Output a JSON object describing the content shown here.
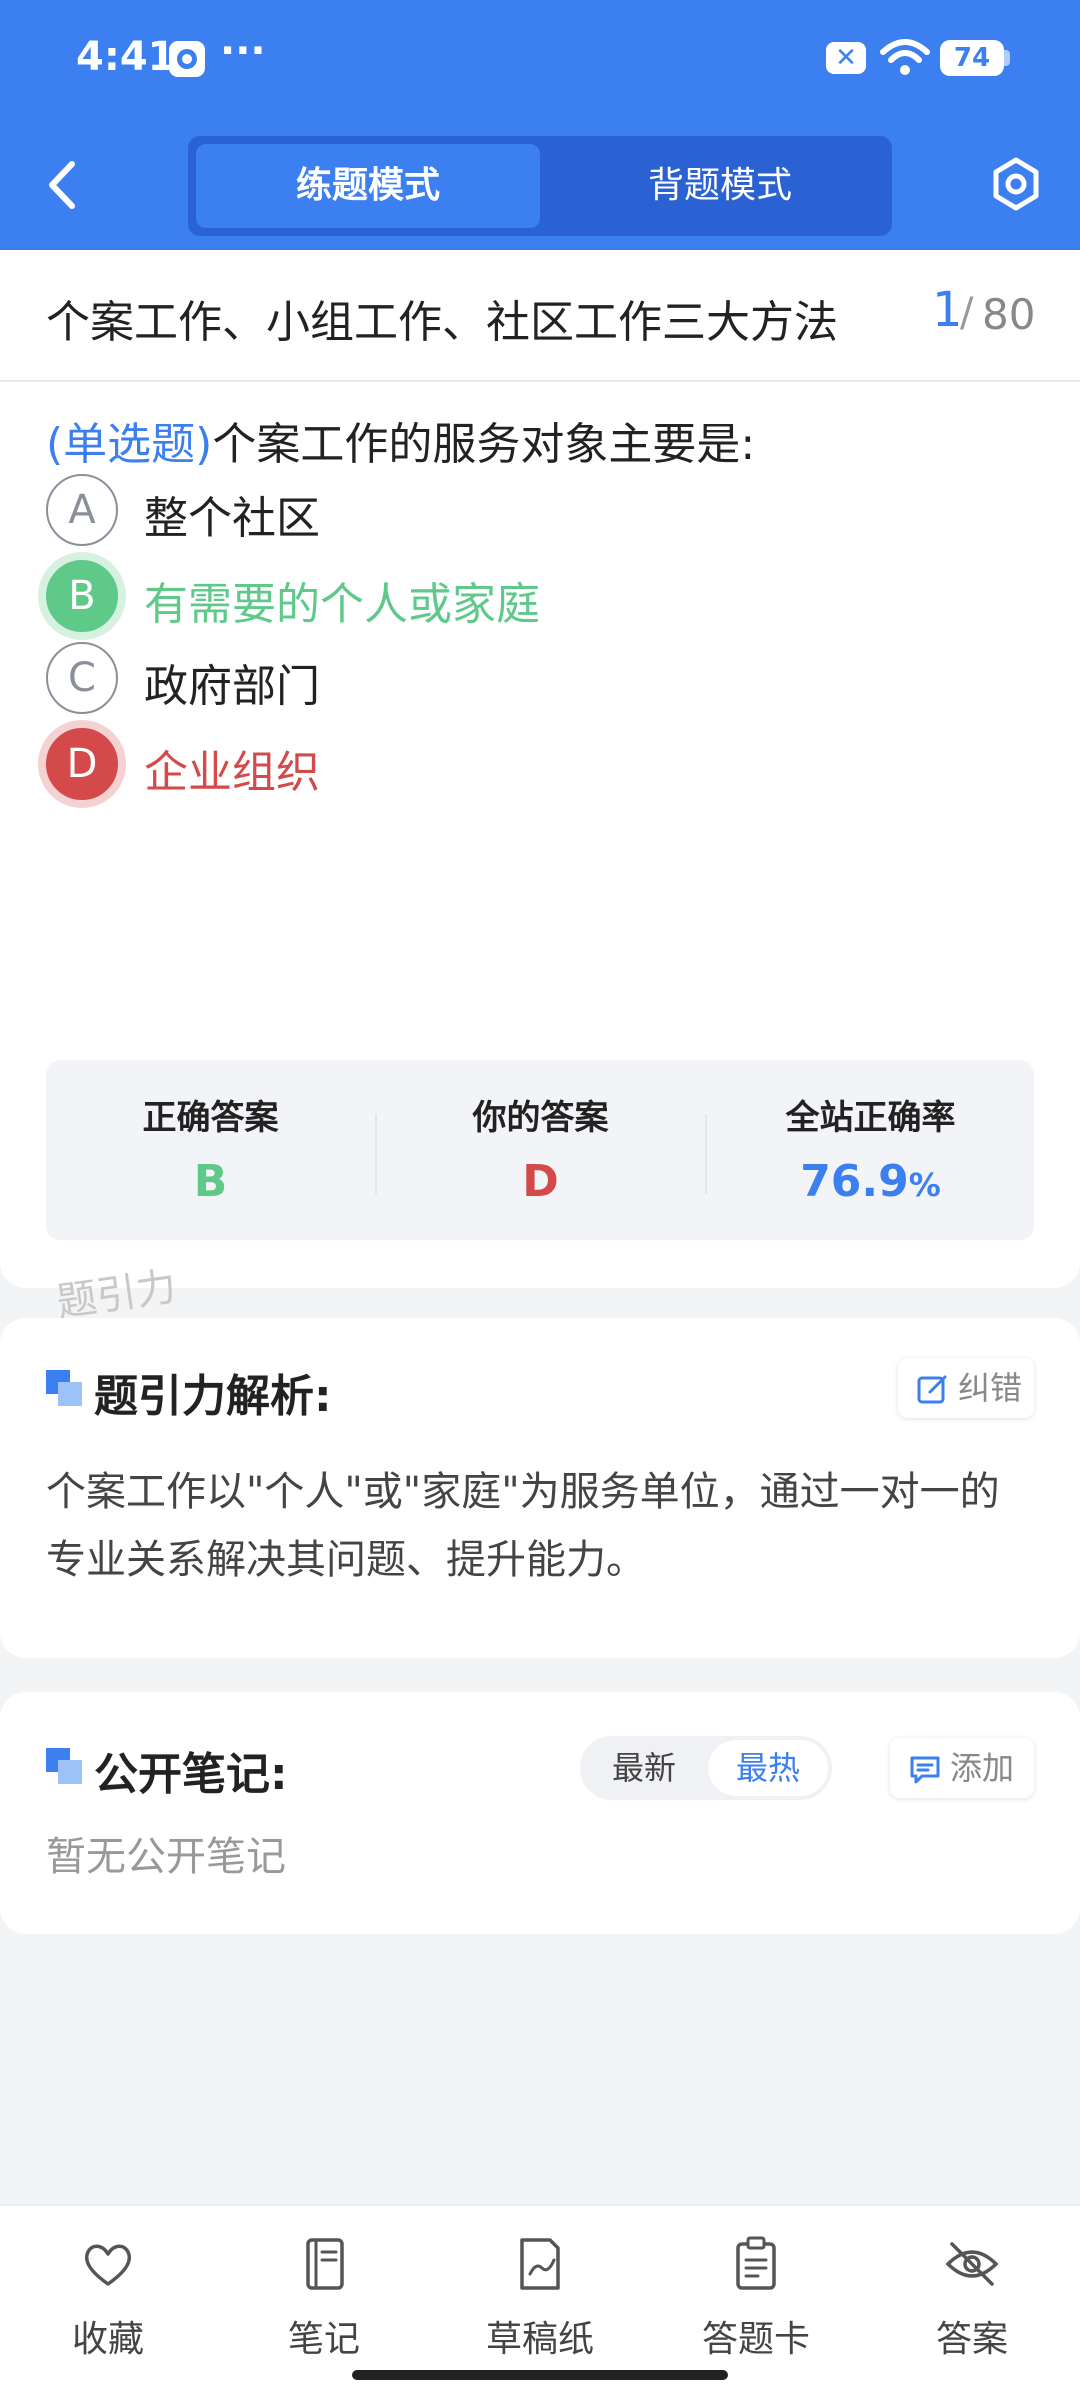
{
  "status_bar": {
    "time": "4:41",
    "battery": "74",
    "more": "···"
  },
  "header": {
    "mode_tabs": [
      {
        "label": "练题模式",
        "active": true
      },
      {
        "label": "背题模式",
        "active": false
      }
    ]
  },
  "title_bar": {
    "chapter_title": "个案工作、小组工作、社区工作三大方法",
    "current": "1",
    "separator": "/",
    "total": "80"
  },
  "question": {
    "type": "(单选题)",
    "text": "个案工作的服务对象主要是:",
    "options": [
      {
        "letter": "A",
        "text": "整个社区",
        "state": "normal"
      },
      {
        "letter": "B",
        "text": "有需要的个人或家庭",
        "state": "correct"
      },
      {
        "letter": "C",
        "text": "政府部门",
        "state": "normal"
      },
      {
        "letter": "D",
        "text": "企业组织",
        "state": "wrong"
      }
    ]
  },
  "answer_panel": {
    "correct_label": "正确答案",
    "correct_value": "B",
    "yours_label": "你的答案",
    "yours_value": "D",
    "rate_label": "全站正确率",
    "rate_value": "76.9",
    "rate_unit": "%"
  },
  "watermark": "题引力",
  "analysis": {
    "title": "题引力解析:",
    "report_button": "纠错",
    "body": "个案工作以\"个人\"或\"家庭\"为服务单位，通过一对一的专业关系解决其问题、提升能力。"
  },
  "notes": {
    "title": "公开笔记:",
    "sort_newest": "最新",
    "sort_hottest": "最热",
    "add_button": "添加",
    "empty_text": "暂无公开笔记"
  },
  "bottom_nav": [
    {
      "label": "收藏",
      "icon": "heart-icon"
    },
    {
      "label": "笔记",
      "icon": "notebook-icon"
    },
    {
      "label": "草稿纸",
      "icon": "scratch-paper-icon"
    },
    {
      "label": "答题卡",
      "icon": "answer-card-icon"
    },
    {
      "label": "答案",
      "icon": "eye-off-icon"
    }
  ],
  "colors": {
    "brand": "#3b7ff0",
    "correct": "#5fc98a",
    "wrong": "#d44a4a"
  }
}
